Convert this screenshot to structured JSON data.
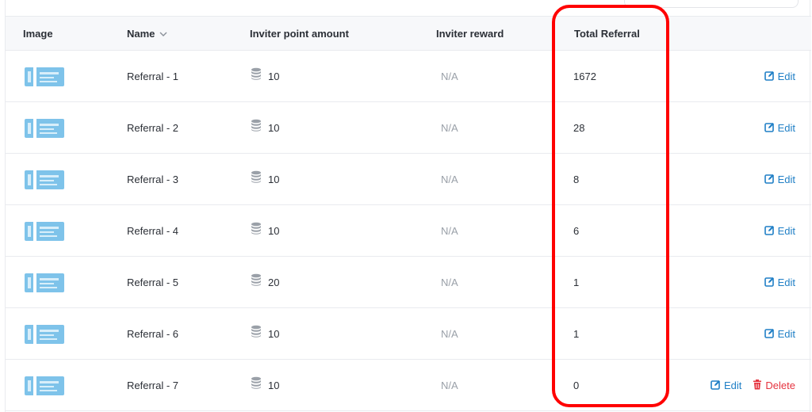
{
  "table": {
    "columns": {
      "image": "Image",
      "name": "Name",
      "inviter_point_amount": "Inviter point amount",
      "inviter_reward": "Inviter reward",
      "total_referral": "Total Referral"
    },
    "rows": [
      {
        "name": "Referral - 1",
        "points": "10",
        "reward": "N/A",
        "total": "1672",
        "edit": "Edit"
      },
      {
        "name": "Referral - 2",
        "points": "10",
        "reward": "N/A",
        "total": "28",
        "edit": "Edit"
      },
      {
        "name": "Referral - 3",
        "points": "10",
        "reward": "N/A",
        "total": "8",
        "edit": "Edit"
      },
      {
        "name": "Referral - 4",
        "points": "10",
        "reward": "N/A",
        "total": "6",
        "edit": "Edit"
      },
      {
        "name": "Referral - 5",
        "points": "20",
        "reward": "N/A",
        "total": "1",
        "edit": "Edit"
      },
      {
        "name": "Referral - 6",
        "points": "10",
        "reward": "N/A",
        "total": "1",
        "edit": "Edit"
      },
      {
        "name": "Referral - 7",
        "points": "10",
        "reward": "N/A",
        "total": "0",
        "edit": "Edit",
        "delete": "Delete"
      }
    ]
  },
  "icons": {
    "sort": "chevron-down-icon",
    "points": "coins-stack-icon",
    "edit": "edit-icon",
    "delete": "trash-icon",
    "thumbnail": "ticket-icon"
  },
  "colors": {
    "edit": "#1f7fc6",
    "delete": "#e5323e",
    "highlight": "#ff0000",
    "thumbnail": "#7ec3ea"
  }
}
